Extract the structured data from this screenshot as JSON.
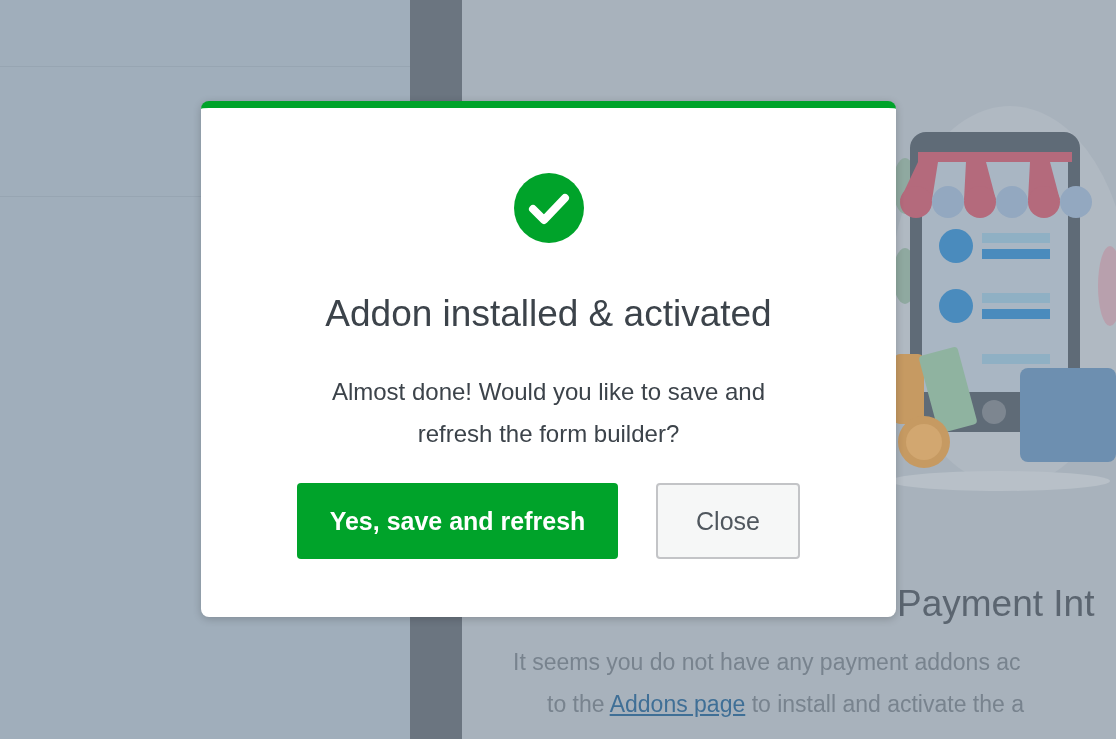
{
  "background": {
    "heading": "Payment Int",
    "description": {
      "line_1": "It seems you do not have any payment addons ac",
      "line_2_before": "to the",
      "link": "Addons page",
      "line_2_after": "to install and activate the a"
    }
  },
  "modal": {
    "title": "Addon installed & activated",
    "message": "Almost done! Would you like to save and refresh the form builder?",
    "buttons": [
      {
        "label": "Yes, save and refresh",
        "kind": "primary"
      },
      {
        "label": "Close",
        "kind": "secondary"
      }
    ]
  }
}
